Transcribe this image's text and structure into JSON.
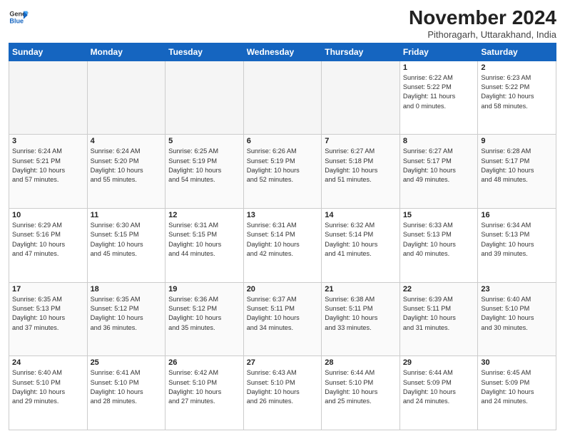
{
  "header": {
    "logo_line1": "General",
    "logo_line2": "Blue",
    "month": "November 2024",
    "location": "Pithoragarh, Uttarakhand, India"
  },
  "weekdays": [
    "Sunday",
    "Monday",
    "Tuesday",
    "Wednesday",
    "Thursday",
    "Friday",
    "Saturday"
  ],
  "weeks": [
    [
      {
        "day": "",
        "info": ""
      },
      {
        "day": "",
        "info": ""
      },
      {
        "day": "",
        "info": ""
      },
      {
        "day": "",
        "info": ""
      },
      {
        "day": "",
        "info": ""
      },
      {
        "day": "1",
        "info": "Sunrise: 6:22 AM\nSunset: 5:22 PM\nDaylight: 11 hours\nand 0 minutes."
      },
      {
        "day": "2",
        "info": "Sunrise: 6:23 AM\nSunset: 5:22 PM\nDaylight: 10 hours\nand 58 minutes."
      }
    ],
    [
      {
        "day": "3",
        "info": "Sunrise: 6:24 AM\nSunset: 5:21 PM\nDaylight: 10 hours\nand 57 minutes."
      },
      {
        "day": "4",
        "info": "Sunrise: 6:24 AM\nSunset: 5:20 PM\nDaylight: 10 hours\nand 55 minutes."
      },
      {
        "day": "5",
        "info": "Sunrise: 6:25 AM\nSunset: 5:19 PM\nDaylight: 10 hours\nand 54 minutes."
      },
      {
        "day": "6",
        "info": "Sunrise: 6:26 AM\nSunset: 5:19 PM\nDaylight: 10 hours\nand 52 minutes."
      },
      {
        "day": "7",
        "info": "Sunrise: 6:27 AM\nSunset: 5:18 PM\nDaylight: 10 hours\nand 51 minutes."
      },
      {
        "day": "8",
        "info": "Sunrise: 6:27 AM\nSunset: 5:17 PM\nDaylight: 10 hours\nand 49 minutes."
      },
      {
        "day": "9",
        "info": "Sunrise: 6:28 AM\nSunset: 5:17 PM\nDaylight: 10 hours\nand 48 minutes."
      }
    ],
    [
      {
        "day": "10",
        "info": "Sunrise: 6:29 AM\nSunset: 5:16 PM\nDaylight: 10 hours\nand 47 minutes."
      },
      {
        "day": "11",
        "info": "Sunrise: 6:30 AM\nSunset: 5:15 PM\nDaylight: 10 hours\nand 45 minutes."
      },
      {
        "day": "12",
        "info": "Sunrise: 6:31 AM\nSunset: 5:15 PM\nDaylight: 10 hours\nand 44 minutes."
      },
      {
        "day": "13",
        "info": "Sunrise: 6:31 AM\nSunset: 5:14 PM\nDaylight: 10 hours\nand 42 minutes."
      },
      {
        "day": "14",
        "info": "Sunrise: 6:32 AM\nSunset: 5:14 PM\nDaylight: 10 hours\nand 41 minutes."
      },
      {
        "day": "15",
        "info": "Sunrise: 6:33 AM\nSunset: 5:13 PM\nDaylight: 10 hours\nand 40 minutes."
      },
      {
        "day": "16",
        "info": "Sunrise: 6:34 AM\nSunset: 5:13 PM\nDaylight: 10 hours\nand 39 minutes."
      }
    ],
    [
      {
        "day": "17",
        "info": "Sunrise: 6:35 AM\nSunset: 5:13 PM\nDaylight: 10 hours\nand 37 minutes."
      },
      {
        "day": "18",
        "info": "Sunrise: 6:35 AM\nSunset: 5:12 PM\nDaylight: 10 hours\nand 36 minutes."
      },
      {
        "day": "19",
        "info": "Sunrise: 6:36 AM\nSunset: 5:12 PM\nDaylight: 10 hours\nand 35 minutes."
      },
      {
        "day": "20",
        "info": "Sunrise: 6:37 AM\nSunset: 5:11 PM\nDaylight: 10 hours\nand 34 minutes."
      },
      {
        "day": "21",
        "info": "Sunrise: 6:38 AM\nSunset: 5:11 PM\nDaylight: 10 hours\nand 33 minutes."
      },
      {
        "day": "22",
        "info": "Sunrise: 6:39 AM\nSunset: 5:11 PM\nDaylight: 10 hours\nand 31 minutes."
      },
      {
        "day": "23",
        "info": "Sunrise: 6:40 AM\nSunset: 5:10 PM\nDaylight: 10 hours\nand 30 minutes."
      }
    ],
    [
      {
        "day": "24",
        "info": "Sunrise: 6:40 AM\nSunset: 5:10 PM\nDaylight: 10 hours\nand 29 minutes."
      },
      {
        "day": "25",
        "info": "Sunrise: 6:41 AM\nSunset: 5:10 PM\nDaylight: 10 hours\nand 28 minutes."
      },
      {
        "day": "26",
        "info": "Sunrise: 6:42 AM\nSunset: 5:10 PM\nDaylight: 10 hours\nand 27 minutes."
      },
      {
        "day": "27",
        "info": "Sunrise: 6:43 AM\nSunset: 5:10 PM\nDaylight: 10 hours\nand 26 minutes."
      },
      {
        "day": "28",
        "info": "Sunrise: 6:44 AM\nSunset: 5:10 PM\nDaylight: 10 hours\nand 25 minutes."
      },
      {
        "day": "29",
        "info": "Sunrise: 6:44 AM\nSunset: 5:09 PM\nDaylight: 10 hours\nand 24 minutes."
      },
      {
        "day": "30",
        "info": "Sunrise: 6:45 AM\nSunset: 5:09 PM\nDaylight: 10 hours\nand 24 minutes."
      }
    ]
  ]
}
